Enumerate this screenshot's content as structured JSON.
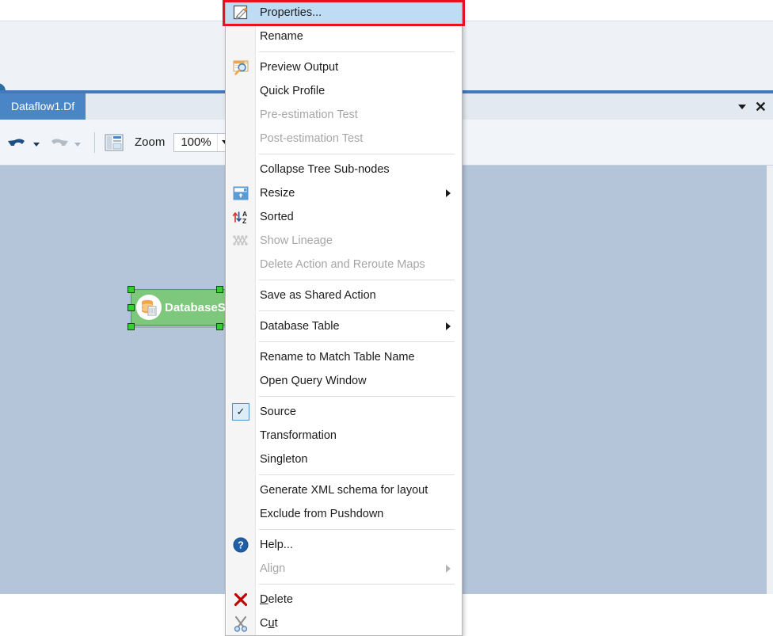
{
  "window": {
    "tab": {
      "label": "Dataflow1.Df"
    },
    "tabbar_controls": {
      "dropdown_icon": "chevron-down-icon",
      "close_icon": "close-icon"
    }
  },
  "toolbar": {
    "undo_icon": "undo-arrow-icon",
    "redo_icon": "redo-arrow-icon",
    "layout_icon": "layout-panel-icon",
    "zoom_label": "Zoom",
    "zoom_value": "100%",
    "resize_icon": "resize-icon"
  },
  "canvas": {
    "node": {
      "label": "DatabaseS",
      "icon": "database-cylinder-icon",
      "fill_color": "#7ec87e",
      "selected": true
    },
    "background_color": "#b4c5da"
  },
  "context_menu": {
    "highlight_color": "#bfdcf5",
    "focus_box_color": "#e81123",
    "items": [
      {
        "id": "properties",
        "label": "Properties...",
        "icon": "properties-pencil-icon",
        "state": "highlighted"
      },
      {
        "id": "rename",
        "label": "Rename",
        "icon": null,
        "state": "enabled"
      },
      {
        "id": "sep1",
        "type": "separator"
      },
      {
        "id": "preview-output",
        "label": "Preview Output",
        "icon": "preview-magnifier-icon",
        "state": "enabled"
      },
      {
        "id": "quick-profile",
        "label": "Quick Profile",
        "icon": null,
        "state": "enabled"
      },
      {
        "id": "pre-est-test",
        "label": "Pre-estimation Test",
        "icon": null,
        "state": "disabled"
      },
      {
        "id": "post-est-test",
        "label": "Post-estimation Test",
        "icon": null,
        "state": "disabled"
      },
      {
        "id": "sep2",
        "type": "separator"
      },
      {
        "id": "collapse-tree",
        "label": "Collapse Tree Sub-nodes",
        "icon": null,
        "state": "enabled"
      },
      {
        "id": "resize",
        "label": "Resize",
        "icon": "resize-box-icon",
        "state": "enabled",
        "submenu": true
      },
      {
        "id": "sorted",
        "label": "Sorted",
        "icon": "sort-az-icon",
        "state": "enabled"
      },
      {
        "id": "show-lineage",
        "label": "Show Lineage",
        "icon": "lineage-graph-icon",
        "state": "disabled"
      },
      {
        "id": "delete-reroute",
        "label": "Delete Action and Reroute Maps",
        "icon": null,
        "state": "disabled"
      },
      {
        "id": "sep3",
        "type": "separator"
      },
      {
        "id": "save-shared",
        "label": "Save as Shared Action",
        "icon": null,
        "state": "enabled"
      },
      {
        "id": "sep4",
        "type": "separator"
      },
      {
        "id": "database-table",
        "label": "Database Table",
        "icon": null,
        "state": "enabled",
        "submenu": true
      },
      {
        "id": "sep5",
        "type": "separator"
      },
      {
        "id": "rename-match",
        "label": "Rename to Match Table Name",
        "icon": null,
        "state": "enabled"
      },
      {
        "id": "open-query",
        "label": "Open Query Window",
        "icon": null,
        "state": "enabled"
      },
      {
        "id": "sep6",
        "type": "separator"
      },
      {
        "id": "source",
        "label": "Source",
        "icon": "checkbox-checked-icon",
        "state": "enabled",
        "checked": true
      },
      {
        "id": "transformation",
        "label": "Transformation",
        "icon": null,
        "state": "enabled"
      },
      {
        "id": "singleton",
        "label": "Singleton",
        "icon": null,
        "state": "enabled"
      },
      {
        "id": "sep7",
        "type": "separator"
      },
      {
        "id": "generate-xml",
        "label": "Generate XML schema for layout",
        "icon": null,
        "state": "enabled"
      },
      {
        "id": "exclude-push",
        "label": "Exclude from Pushdown",
        "icon": null,
        "state": "enabled"
      },
      {
        "id": "sep8",
        "type": "separator"
      },
      {
        "id": "help",
        "label": "Help...",
        "icon": "help-question-icon",
        "state": "enabled"
      },
      {
        "id": "align",
        "label": "Align",
        "icon": null,
        "state": "disabled",
        "submenu": true
      },
      {
        "id": "sep9",
        "type": "separator"
      },
      {
        "id": "delete",
        "label": "Delete",
        "icon": "delete-x-icon",
        "state": "enabled",
        "accel": "D"
      },
      {
        "id": "cut",
        "label": "Cut",
        "icon": "scissors-icon",
        "state": "enabled",
        "accel": "u"
      }
    ]
  }
}
